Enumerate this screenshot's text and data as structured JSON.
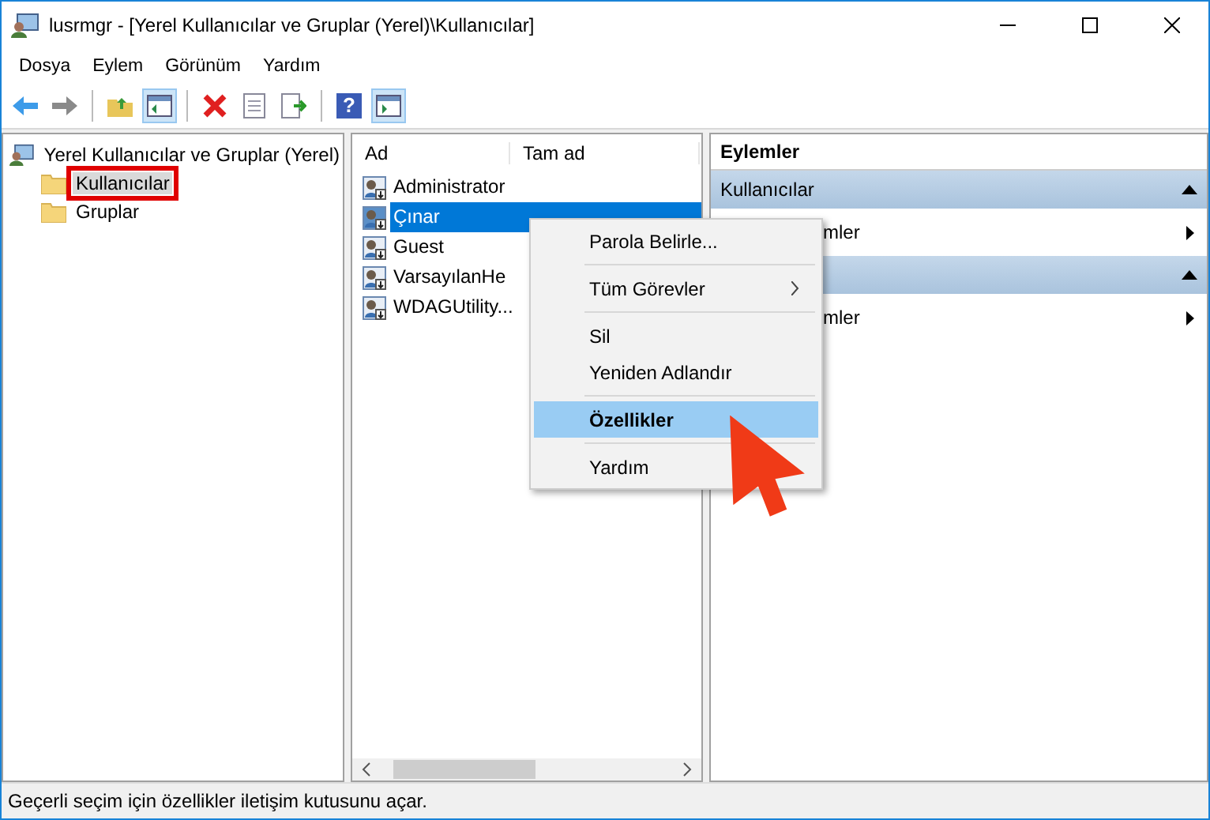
{
  "window": {
    "title": "lusrmgr - [Yerel Kullanıcılar ve Gruplar (Yerel)\\Kullanıcılar]"
  },
  "menu": [
    "Dosya",
    "Eylem",
    "Görünüm",
    "Yardım"
  ],
  "toolbar": {
    "help_glyph": "?"
  },
  "tree": {
    "label": "Yerel Kullanıcılar ve Gruplar (Yerel)",
    "expanded": true,
    "children": [
      {
        "label": "Kullanıcılar",
        "selected": true,
        "highlighted": true
      },
      {
        "label": "Gruplar",
        "selected": false,
        "highlighted": false
      }
    ]
  },
  "list": {
    "columns": [
      "Ad",
      "Tam ad"
    ],
    "rows": [
      {
        "name": "Administrator",
        "selected": false
      },
      {
        "name": "Çınar",
        "selected": true
      },
      {
        "name": "Guest",
        "selected": false
      },
      {
        "name": "VarsayılanHe",
        "selected": false
      },
      {
        "name": "WDAGUtility...",
        "selected": false
      }
    ]
  },
  "actions": {
    "title": "Eylemler",
    "sections": [
      {
        "title": "Kullanıcılar",
        "items": [
          "mler"
        ]
      },
      {
        "items": [
          "mler"
        ]
      }
    ]
  },
  "context_menu": {
    "items": [
      {
        "kind": "item",
        "label": "Parola Belirle...",
        "selected": false,
        "submenu": false
      },
      {
        "kind": "separator"
      },
      {
        "kind": "item",
        "label": "Tüm Görevler",
        "selected": false,
        "submenu": true
      },
      {
        "kind": "separator"
      },
      {
        "kind": "item",
        "label": "Sil",
        "selected": false,
        "submenu": false
      },
      {
        "kind": "item",
        "label": "Yeniden Adlandır",
        "selected": false,
        "submenu": false
      },
      {
        "kind": "separator"
      },
      {
        "kind": "item",
        "label": "Özellikler",
        "selected": true,
        "submenu": false
      },
      {
        "kind": "separator"
      },
      {
        "kind": "item",
        "label": "Yardım",
        "selected": false,
        "submenu": false
      }
    ]
  },
  "status_bar": {
    "text": "Geçerli seçim için özellikler iletişim kutusunu açar."
  }
}
